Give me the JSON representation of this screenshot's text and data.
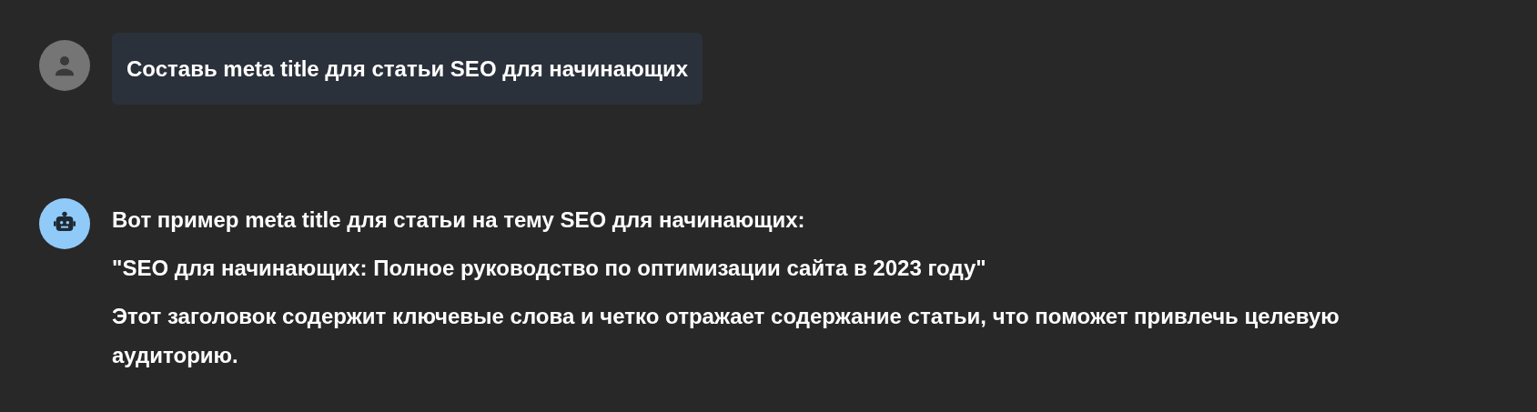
{
  "messages": [
    {
      "kind": "user",
      "paragraphs": [
        "Составь meta title для статьи SEO для начинающих"
      ]
    },
    {
      "kind": "assistant",
      "paragraphs": [
        "Вот пример meta title для статьи на тему SEO для начинающих:",
        "\"SEO для начинающих: Полное руководство по оптимизации сайта в 2023 году\"",
        "Этот заголовок содержит ключевые слова и четко отражает содержание статьи, что поможет привлечь целевую аудиторию."
      ]
    }
  ]
}
